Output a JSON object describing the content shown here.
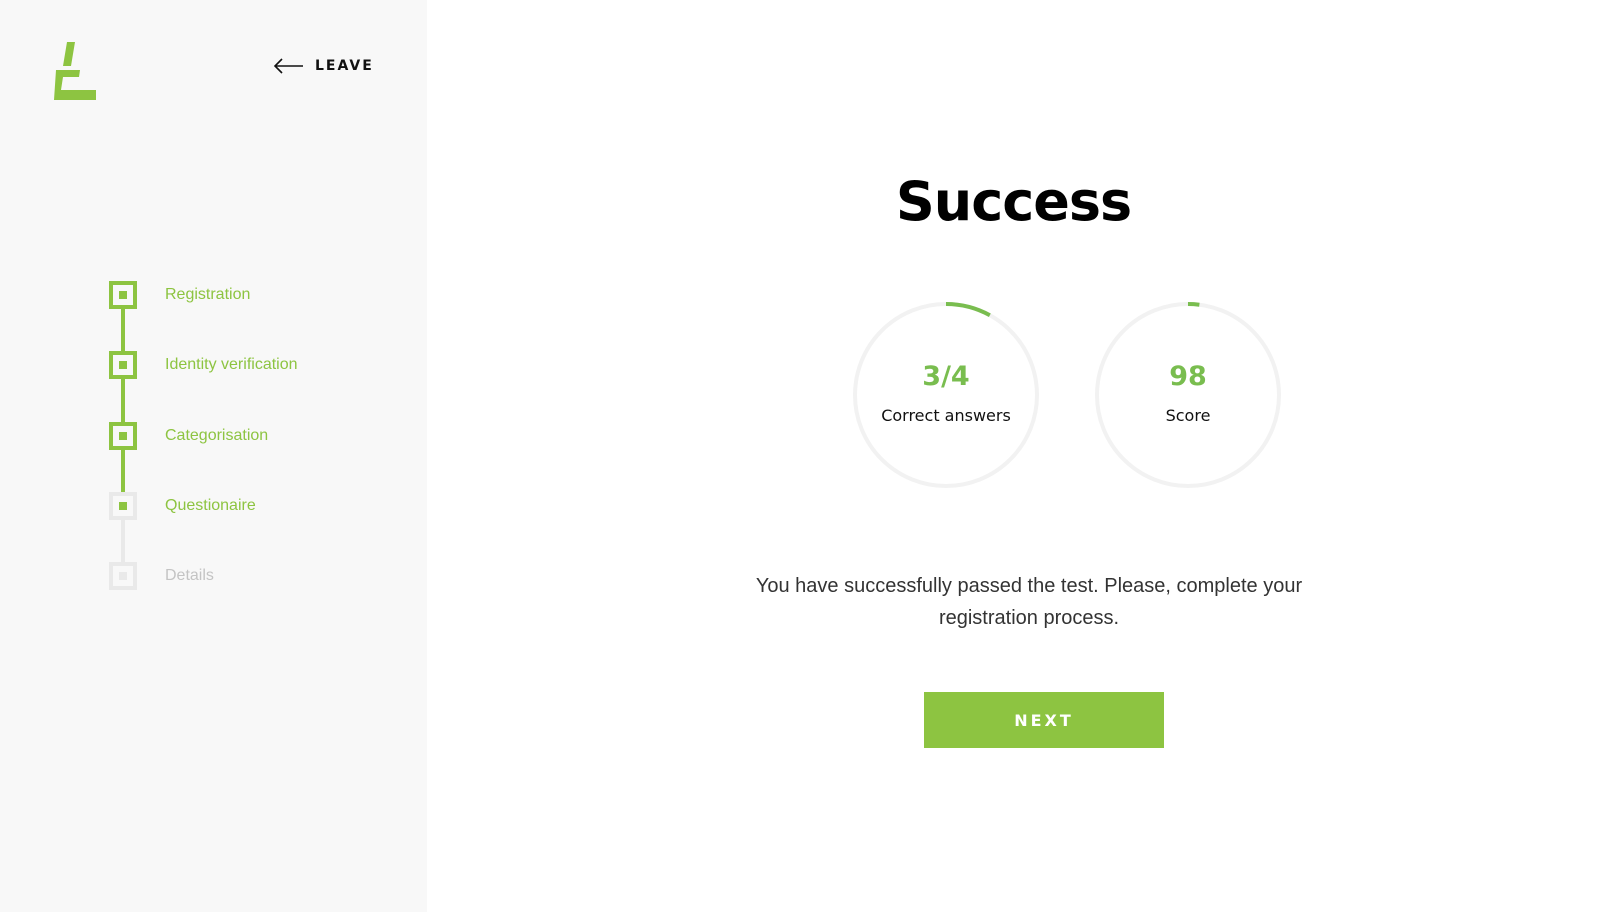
{
  "colors": {
    "accent": "#8dc441",
    "accent_text": "#79bd4f",
    "inactive": "#e9e9e9",
    "sidebar_bg": "#f8f8f8"
  },
  "header": {
    "logo_icon": "brand-logo-icon",
    "leave_icon": "arrow-left-icon",
    "leave_label": "LEAVE"
  },
  "steps": [
    {
      "label": "Registration",
      "state": "done"
    },
    {
      "label": "Identity verification",
      "state": "done"
    },
    {
      "label": "Categorisation",
      "state": "done"
    },
    {
      "label": "Questionaire",
      "state": "current"
    },
    {
      "label": "Details",
      "state": "pending"
    }
  ],
  "result": {
    "title": "Success",
    "correct": {
      "value": "3/4",
      "label": "Correct answers",
      "progress": 0.08
    },
    "score": {
      "value": "98",
      "label": "Score",
      "progress": 0.02
    },
    "message": "You have successfully passed the test. Please, complete your registration process.",
    "next_label": "NEXT"
  }
}
